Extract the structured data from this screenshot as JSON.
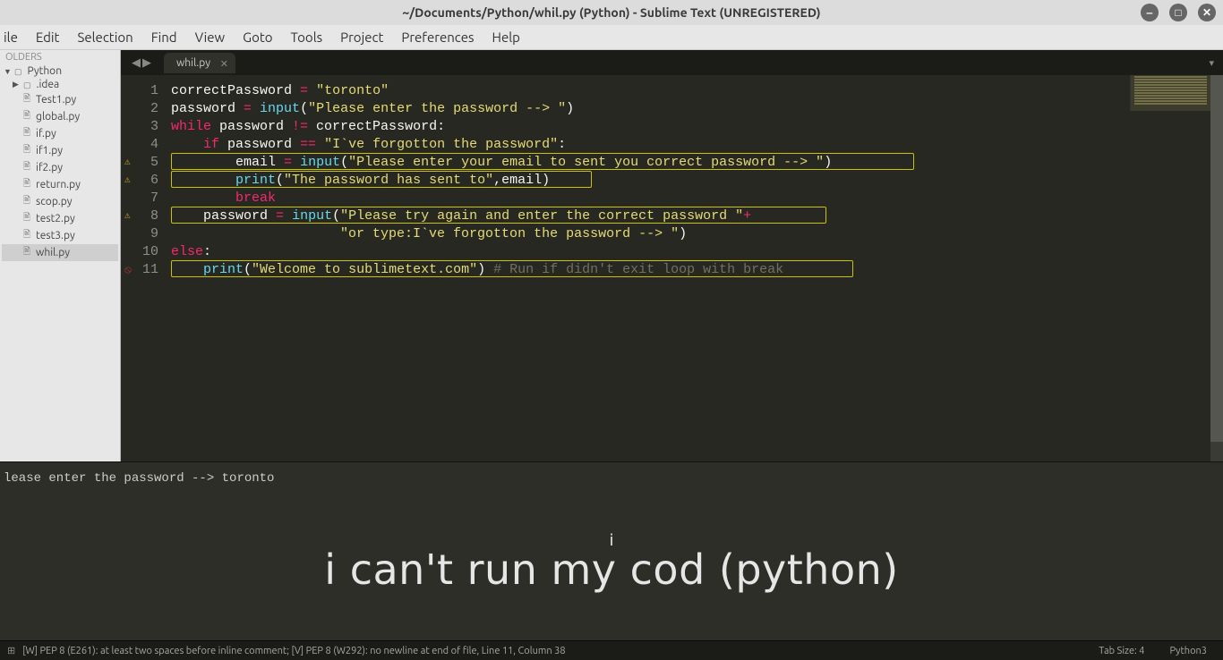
{
  "window": {
    "title": "~/Documents/Python/whil.py (Python) - Sublime Text (UNREGISTERED)"
  },
  "menu": [
    "ile",
    "Edit",
    "Selection",
    "Find",
    "View",
    "Goto",
    "Tools",
    "Project",
    "Preferences",
    "Help"
  ],
  "sidebar": {
    "header": "OLDERS",
    "root": "Python",
    "folders": [
      ".idea"
    ],
    "files": [
      "Test1.py",
      "global.py",
      "if.py",
      "if1.py",
      "if2.py",
      "return.py",
      "scop.py",
      "test2.py",
      "test3.py",
      "whil.py"
    ],
    "active": "whil.py"
  },
  "tab": {
    "name": "whil.py"
  },
  "code": {
    "lines": [
      {
        "num": "1",
        "warn": "",
        "tokens": [
          [
            "",
            "correctPassword "
          ],
          [
            "op",
            "="
          ],
          [
            "",
            " "
          ],
          [
            "str",
            "\"toronto\""
          ]
        ]
      },
      {
        "num": "2",
        "warn": "",
        "tokens": [
          [
            "",
            "password "
          ],
          [
            "op",
            "="
          ],
          [
            "",
            " "
          ],
          [
            "fn",
            "input"
          ],
          [
            "pun",
            "("
          ],
          [
            "str",
            "\"Please enter the password --> \""
          ],
          [
            "pun",
            ")"
          ]
        ]
      },
      {
        "num": "3",
        "warn": "",
        "tokens": [
          [
            "kw",
            "while"
          ],
          [
            "",
            " password "
          ],
          [
            "op",
            "!="
          ],
          [
            "",
            " correctPassword"
          ],
          [
            "pun",
            ":"
          ]
        ]
      },
      {
        "num": "4",
        "warn": "",
        "tokens": [
          [
            "",
            "    "
          ],
          [
            "kw",
            "if"
          ],
          [
            "",
            " password "
          ],
          [
            "op",
            "=="
          ],
          [
            "",
            " "
          ],
          [
            "str",
            "\"I`ve forgotton the password\""
          ],
          [
            "pun",
            ":"
          ]
        ]
      },
      {
        "num": "5",
        "warn": "warn",
        "tokens": [
          [
            "",
            "        email "
          ],
          [
            "op",
            "="
          ],
          [
            "",
            " "
          ],
          [
            "fn",
            "input"
          ],
          [
            "pun",
            "("
          ],
          [
            "str",
            "\"Please enter your email to sent you correct password --> \""
          ],
          [
            "pun",
            ")"
          ]
        ]
      },
      {
        "num": "6",
        "warn": "warn",
        "tokens": [
          [
            "",
            "        "
          ],
          [
            "fn",
            "print"
          ],
          [
            "pun",
            "("
          ],
          [
            "str",
            "\"The password has sent to\""
          ],
          [
            "pun",
            ","
          ],
          [
            "",
            "email"
          ],
          [
            "pun",
            ")"
          ]
        ]
      },
      {
        "num": "7",
        "warn": "",
        "tokens": [
          [
            "",
            "        "
          ],
          [
            "kw",
            "break"
          ]
        ]
      },
      {
        "num": "8",
        "warn": "warn",
        "tokens": [
          [
            "",
            "    password "
          ],
          [
            "op",
            "="
          ],
          [
            "",
            " "
          ],
          [
            "fn",
            "input"
          ],
          [
            "pun",
            "("
          ],
          [
            "str",
            "\"Please try again and enter the correct password \""
          ],
          [
            "op",
            "+"
          ]
        ]
      },
      {
        "num": "9",
        "warn": "",
        "tokens": [
          [
            "",
            "                     "
          ],
          [
            "str",
            "\"or type:I`ve forgotton the password --> \""
          ],
          [
            "pun",
            ")"
          ]
        ]
      },
      {
        "num": "10",
        "warn": "",
        "tokens": [
          [
            "kw",
            "else"
          ],
          [
            "pun",
            ":"
          ]
        ]
      },
      {
        "num": "11",
        "warn": "err",
        "tokens": [
          [
            "",
            "    "
          ],
          [
            "fn",
            "print"
          ],
          [
            "pun",
            "("
          ],
          [
            "str",
            "\"Welcome to sublimetext.com\""
          ],
          [
            "pun",
            ")"
          ],
          [
            "",
            " "
          ],
          [
            "cmt",
            "# Run if didn't exit loop with break"
          ]
        ]
      }
    ]
  },
  "console": {
    "text": "lease enter the password --> toronto"
  },
  "overlay": {
    "small": "i",
    "big": "i can't run my cod (python)"
  },
  "statusbar": {
    "left": "[W] PEP 8 (E261): at least two spaces before inline comment; [V] PEP 8 (W292): no newline at end of file, Line 11, Column 38",
    "tabsize": "Tab Size: 4",
    "lang": "Python3"
  }
}
